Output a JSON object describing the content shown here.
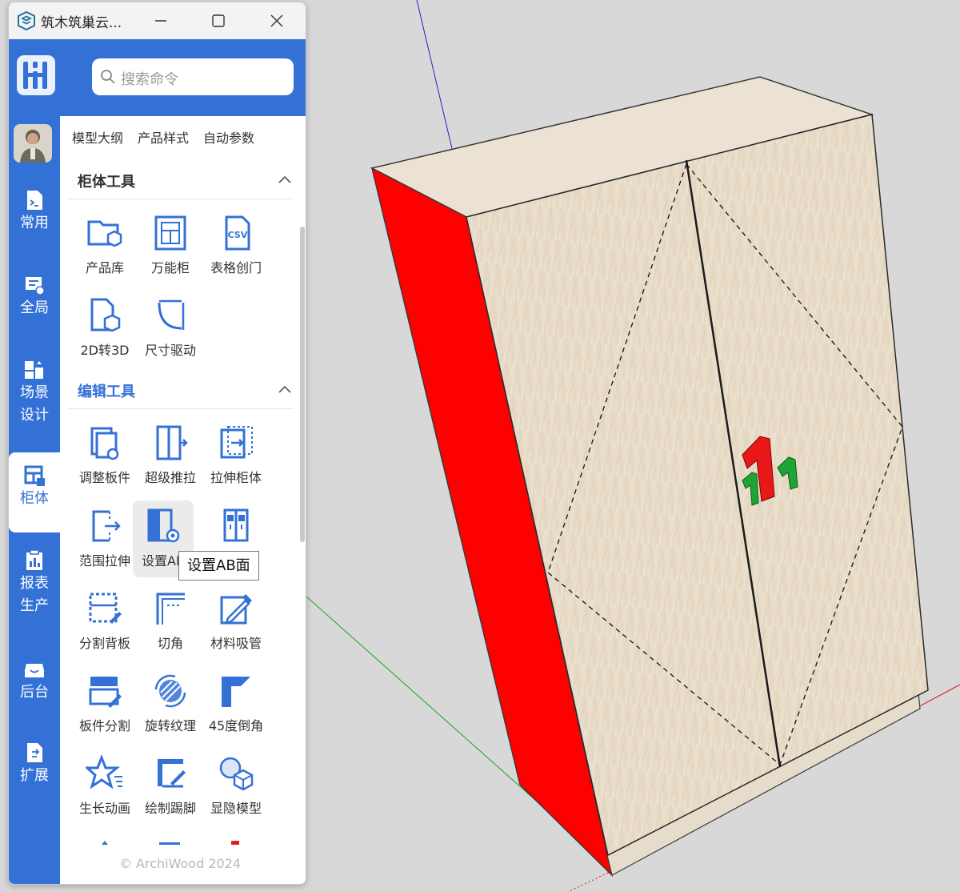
{
  "window": {
    "title": "筑木筑巢云..."
  },
  "search": {
    "placeholder": "搜索命令"
  },
  "sidebar": {
    "items": [
      {
        "label": "常用",
        "icon": "terminal-doc-icon"
      },
      {
        "label": "全局",
        "icon": "settings-panel-icon"
      },
      {
        "label": "场景\n设计",
        "icon": "scene-design-icon"
      },
      {
        "label": "柜体",
        "icon": "cabinet-icon",
        "active": true
      },
      {
        "label": "报表\n生产",
        "icon": "report-icon"
      },
      {
        "label": "后台",
        "icon": "inbox-tray-icon"
      },
      {
        "label": "扩展",
        "icon": "extension-doc-icon"
      }
    ]
  },
  "top_tools": [
    "模型大纲",
    "产品样式",
    "自动参数"
  ],
  "sections": {
    "cabinet_tools": {
      "title": "柜体工具",
      "tools": [
        "产品库",
        "万能柜",
        "表格创门",
        "2D转3D",
        "尺寸驱动"
      ]
    },
    "edit_tools": {
      "title": "编辑工具",
      "tools": [
        "调整板件",
        "超级推拉",
        "拉伸柜体",
        "范围拉伸",
        "设置AB",
        "",
        "分割背板",
        "切角",
        "材料吸管",
        "板件分割",
        "旋转纹理",
        "45度倒角",
        "生长动画",
        "绘制踢脚",
        "显隐模型"
      ]
    }
  },
  "tooltip": "设置AB面",
  "copyright": "© ArchiWood 2024",
  "colors": {
    "accent": "#3471d6",
    "side_panel": "#ff0000",
    "wood": "#e9ddcb"
  }
}
